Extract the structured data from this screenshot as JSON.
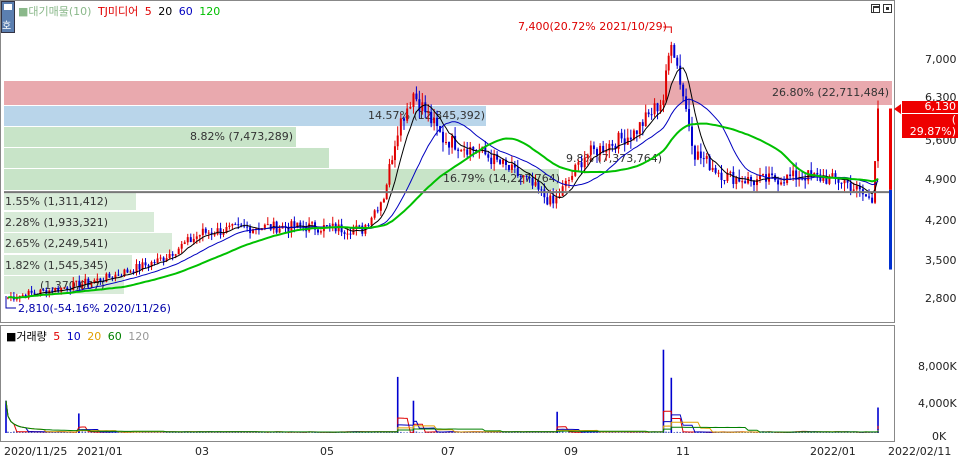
{
  "price_panel": {
    "toggle_label": "호",
    "legend": [
      {
        "label": "■대기매물(10)",
        "color": "#8ab88a"
      },
      {
        "label": "TJ미디어",
        "color": "#e00000"
      },
      {
        "label": "5",
        "color": "#e00000"
      },
      {
        "label": "20",
        "color": "#000000"
      },
      {
        "label": "60",
        "color": "#0000c0"
      },
      {
        "label": "120",
        "color": "#00c000"
      }
    ],
    "y_ticks": [
      "7,000",
      "6,300",
      "5,600",
      "4,900",
      "4,200",
      "3,500",
      "2,800"
    ],
    "current_price": "6,130",
    "current_change": "( 29.87%)",
    "high_annotation": "7,400(20.72% 2021/10/29)",
    "low_annotation": "2,810(-54.16% 2020/11/26)",
    "supply_bands": [
      {
        "label": "26.80% (22,711,484)",
        "pct": 26.8,
        "color": "#e9a9ae"
      },
      {
        "label": "14.57% (12,345,392)",
        "pct": 14.57,
        "color": "#b9d5ea"
      },
      {
        "label": "8.82% (7,473,289)",
        "pct": 8.82,
        "color": "#c8e4c8"
      },
      {
        "label": "9.8% (7,373,764)",
        "pct": 9.8,
        "color": "#c8e4c8"
      },
      {
        "label": "16.79% (14,227,764)",
        "pct": 16.79,
        "color": "#c8e4c8"
      },
      {
        "label": "1.55% (1,311,412)",
        "pct": 1.55,
        "color": "#c8e4c8"
      },
      {
        "label": "2.28% (1,933,321)",
        "pct": 2.28,
        "color": "#c8e4c8"
      },
      {
        "label": "2.65% (2,249,541)",
        "pct": 2.65,
        "color": "#c8e4c8"
      },
      {
        "label": "1.82% (1,545,345)",
        "pct": 1.82,
        "color": "#c8e4c8"
      },
      {
        "label": "(1,370,067)",
        "pct": 1.6,
        "color": "#c8e4c8"
      }
    ]
  },
  "volume_panel": {
    "legend": [
      {
        "label": "■거래량",
        "color": "#000000"
      },
      {
        "label": "5",
        "color": "#e00000"
      },
      {
        "label": "10",
        "color": "#0000c0"
      },
      {
        "label": "20",
        "color": "#e0a000"
      },
      {
        "label": "60",
        "color": "#008000"
      },
      {
        "label": "120",
        "color": "#999999"
      }
    ],
    "y_ticks": [
      "8,000K",
      "4,000K",
      "0K"
    ]
  },
  "x_axis": {
    "dates": [
      "2020/11/25",
      "2021/01",
      "03",
      "05",
      "07",
      "09",
      "11",
      "2022/01",
      "2022/02/11"
    ]
  },
  "chart_data": {
    "type": "candlestick",
    "title": "TJ미디어",
    "x_range": [
      "2020/11/25",
      "2022/02/11"
    ],
    "y_range": [
      2650,
      7650
    ],
    "y_ticks": [
      2800,
      3500,
      4200,
      4900,
      5600,
      6300,
      7000
    ],
    "grid": false,
    "price_points": [
      {
        "date": "2020/11/26",
        "close": 2810
      },
      {
        "date": "2020/12/20",
        "close": 2950
      },
      {
        "date": "2021/01/15",
        "close": 3150
      },
      {
        "date": "2021/02/10",
        "close": 3450
      },
      {
        "date": "2021/03/05",
        "close": 3950
      },
      {
        "date": "2021/04/01",
        "close": 4050
      },
      {
        "date": "2021/05/01",
        "close": 4050
      },
      {
        "date": "2021/05/25",
        "close": 4000
      },
      {
        "date": "2021/06/05",
        "close": 4600
      },
      {
        "date": "2021/06/12",
        "close": 5800
      },
      {
        "date": "2021/06/20",
        "close": 6400
      },
      {
        "date": "2021/07/05",
        "close": 5600
      },
      {
        "date": "2021/07/25",
        "close": 5350
      },
      {
        "date": "2021/08/15",
        "close": 4900
      },
      {
        "date": "2021/08/30",
        "close": 4450
      },
      {
        "date": "2021/09/15",
        "close": 5300
      },
      {
        "date": "2021/10/10",
        "close": 5700
      },
      {
        "date": "2021/10/25",
        "close": 6300
      },
      {
        "date": "2021/10/29",
        "close": 7400
      },
      {
        "date": "2021/11/10",
        "close": 5350
      },
      {
        "date": "2021/11/25",
        "close": 4950
      },
      {
        "date": "2021/12/10",
        "close": 4850
      },
      {
        "date": "2022/01/05",
        "close": 4950
      },
      {
        "date": "2022/01/25",
        "close": 4850
      },
      {
        "date": "2022/02/08",
        "close": 4500
      },
      {
        "date": "2022/02/11",
        "close": 6130
      }
    ],
    "ma": [
      {
        "name": "20",
        "color": "#000000"
      },
      {
        "name": "60",
        "color": "#0000c0"
      },
      {
        "name": "120",
        "color": "#00c000"
      }
    ],
    "volume_ticks": [
      0,
      4000,
      8000
    ],
    "volume_unit": "K",
    "volume_spikes": [
      {
        "date": "2020/11/25",
        "value": 3800
      },
      {
        "date": "2021/01/01",
        "value": 2300
      },
      {
        "date": "2021/06/12",
        "value": 6600
      },
      {
        "date": "2021/06/20",
        "value": 3800
      },
      {
        "date": "2021/09/01",
        "value": 2500
      },
      {
        "date": "2021/10/25",
        "value": 9800
      },
      {
        "date": "2021/10/29",
        "value": 6500
      },
      {
        "date": "2022/02/11",
        "value": 3000
      }
    ]
  }
}
